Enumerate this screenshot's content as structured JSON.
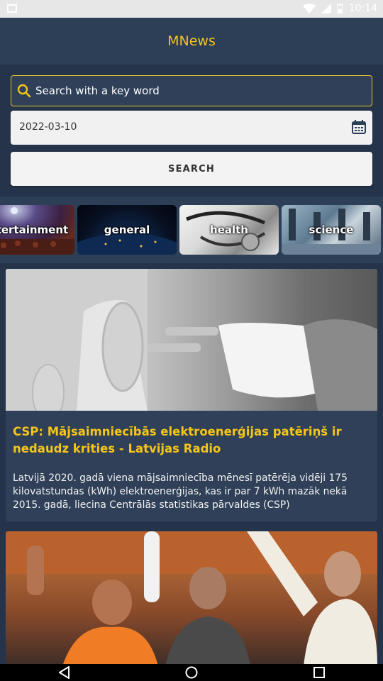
{
  "status_bar": {
    "time": "10:14",
    "icons": [
      "picture-icon",
      "wifi-icon",
      "signal-icon",
      "battery-icon"
    ]
  },
  "app": {
    "title": "MNews",
    "accent_color": "#f5c518"
  },
  "search": {
    "placeholder": "Search with a key word",
    "value": ""
  },
  "date": {
    "value": "2022-03-10"
  },
  "search_button": {
    "label": "SEARCH"
  },
  "categories": [
    {
      "label": "entertainment"
    },
    {
      "label": "general"
    },
    {
      "label": "health"
    },
    {
      "label": "science"
    }
  ],
  "articles": [
    {
      "title": "CSP: Mājsaimniecībās elektroenerģijas patēriņš ir nedaudz krities - Latvijas Radio",
      "description": "Latvijā 2020. gadā viena mājsaimniecība mēnesī patērēja vidēji 175 kilovatstundas (kWh) elektroenerģijas, kas ir par 7 kWh mazāk nekā 2015. gadā, liecina Centrālās statistikas pārvaldes (CSP)",
      "image": "power-plug-photo"
    },
    {
      "title": "",
      "description": "",
      "image": "politicians-crowd-photo"
    }
  ],
  "nav": {
    "buttons": [
      "back-icon",
      "home-icon",
      "recents-icon"
    ]
  }
}
